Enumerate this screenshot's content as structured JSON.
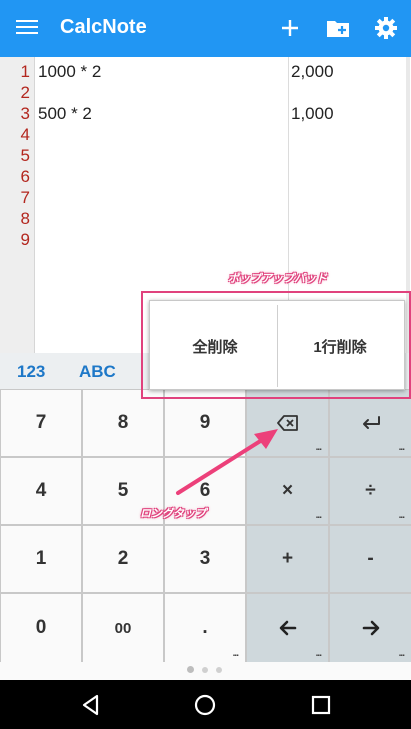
{
  "appbar": {
    "title": "CalcNote",
    "bg_color": "#2196f3"
  },
  "editor": {
    "line_numbers": [
      "1",
      "2",
      "3",
      "4",
      "5",
      "6",
      "7",
      "8",
      "9"
    ],
    "lines": [
      {
        "expr": "1000 * 2",
        "result": "2,000"
      },
      {
        "expr": "",
        "result": ""
      },
      {
        "expr": "500 * 2",
        "result": "1,000"
      }
    ],
    "line_number_color": "#b3261e"
  },
  "keyboard": {
    "tabs": [
      "123",
      "ABC"
    ],
    "tab_color": "#1e78c8",
    "keys": [
      [
        "7",
        "8",
        "9",
        "backspace",
        "enter"
      ],
      [
        "4",
        "5",
        "6",
        "×",
        "÷"
      ],
      [
        "1",
        "2",
        "3",
        "+",
        "-"
      ],
      [
        "0",
        "00",
        ".",
        "←",
        "→"
      ]
    ]
  },
  "popup": {
    "label": "ポップアップパッド",
    "buttons": [
      "全削除",
      "1行削除"
    ],
    "accent_color": "#e0427d"
  },
  "annotation": {
    "long_tap_label": "ロングタップ"
  }
}
